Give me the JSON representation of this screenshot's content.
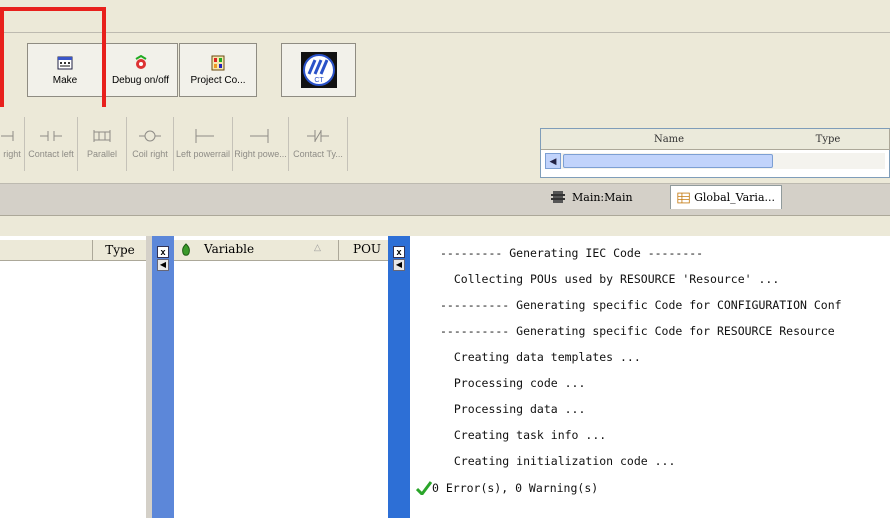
{
  "toolbar1": {
    "make_label": "Make",
    "debug_label": "Debug on/off",
    "project_label": "Project Co...",
    "logo_text": "CT"
  },
  "toolbar2": {
    "items": [
      {
        "label": "right"
      },
      {
        "label": "Contact left"
      },
      {
        "label": "Parallel"
      },
      {
        "label": "Coil right"
      },
      {
        "label": "Left powerrail"
      },
      {
        "label": "Right powe..."
      },
      {
        "label": "Contact Ty..."
      }
    ]
  },
  "mini_table": {
    "columns": [
      "Name",
      "Type"
    ]
  },
  "tabs": [
    {
      "label": "Main:Main",
      "icon": "program-icon"
    },
    {
      "label": "Global_Varia...",
      "icon": "table-icon"
    }
  ],
  "left_panel": {
    "type_header": "Type"
  },
  "variable_panel": {
    "variable_header": "Variable",
    "pou_header": "POU"
  },
  "output_log": [
    "--------- Generating IEC Code --------",
    "  Collecting POUs used by RESOURCE 'Resource' ...",
    "---------- Generating specific Code for CONFIGURATION Conf",
    "---------- Generating specific Code for RESOURCE Resource",
    "  Creating data templates ...",
    "  Processing code ...",
    "  Processing data ...",
    "  Creating task info ...",
    "  Creating initialization code ..."
  ],
  "result_line": "0 Error(s), 0 Warning(s)",
  "colors": {
    "highlight": "#e8201c",
    "panel_bar_mid": "#5c87d9",
    "panel_bar_right": "#2d6fd6",
    "success": "#2aa52a"
  }
}
